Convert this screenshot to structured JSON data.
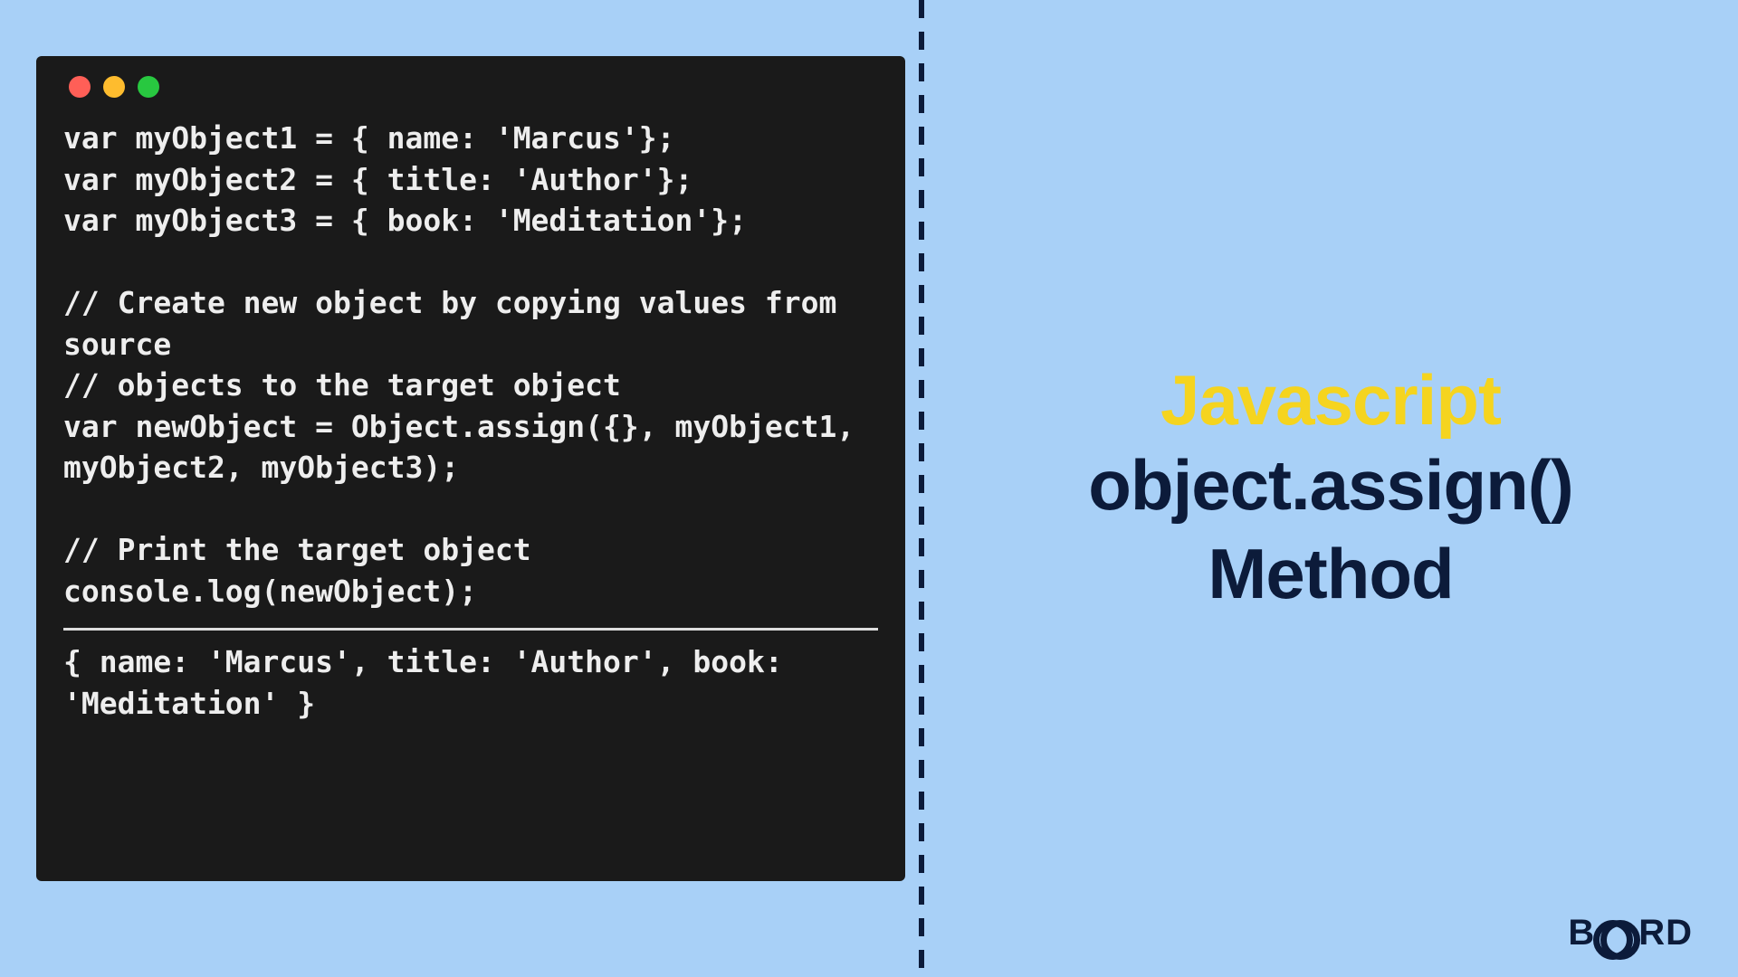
{
  "code_block": {
    "lines": "var myObject1 = { name: 'Marcus'};\nvar myObject2 = { title: 'Author'};\nvar myObject3 = { book: 'Meditation'};\n\n// Create new object by copying values from source\n// objects to the target object\nvar newObject = Object.assign({}, myObject1, myObject2, myObject3);\n\n// Print the target object\nconsole.log(newObject);",
    "output": "{ name: 'Marcus', title: 'Author', book: 'Meditation' }"
  },
  "title": {
    "line1": "Javascript",
    "line2": "object.assign()",
    "line3": "Method"
  },
  "brand": {
    "prefix": "B",
    "suffix": "RD"
  }
}
